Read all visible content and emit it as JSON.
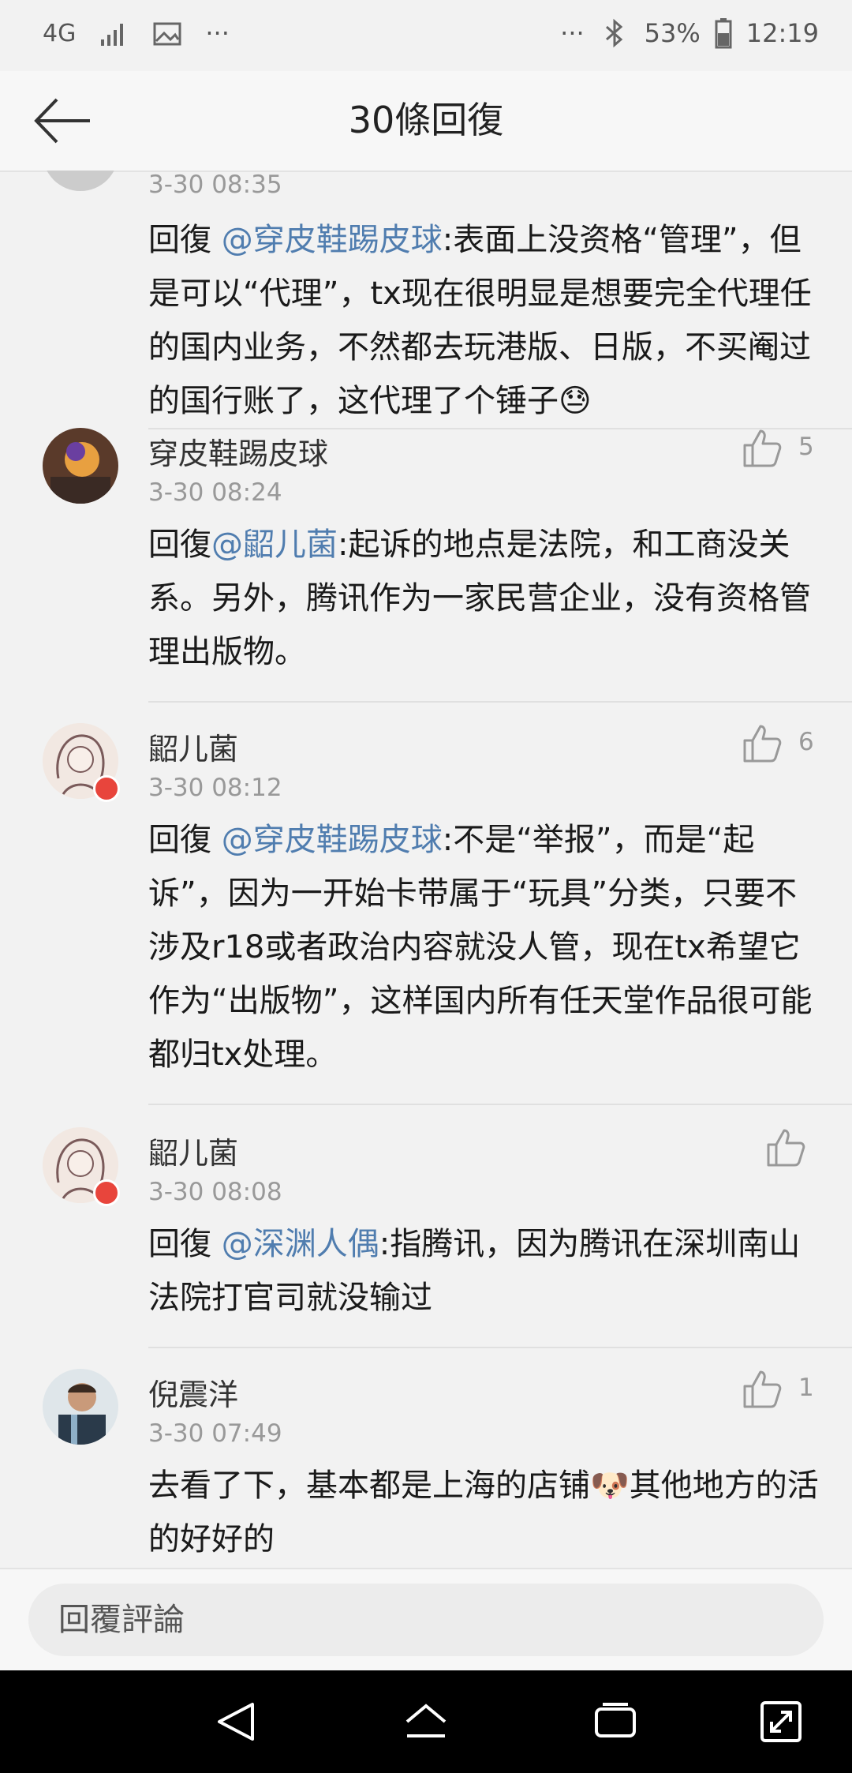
{
  "status_bar": {
    "network": "4G",
    "battery": "53%",
    "time": "12:19",
    "more_left": "···",
    "more_right": "···"
  },
  "header": {
    "title": "30條回復"
  },
  "comments": [
    {
      "time": "3-30 08:35",
      "reply_prefix": "回復 ",
      "mention": "@穿皮鞋踢皮球",
      "text": ":表面上没资格“管理”，但是可以“代理”，tx现在很明显是想要完全代理任的国内业务，不然都去玩港版、日版，不买阉过的国行账了，这代理了个锤子😓"
    },
    {
      "name": "穿皮鞋踢皮球",
      "time": "3-30 08:24",
      "likes": "5",
      "reply_prefix": "回復",
      "mention": "@鼦儿菌",
      "text": ":起诉的地点是法院，和工商没关系。另外，腾讯作为一家民营企业，没有资格管理出版物。"
    },
    {
      "name": "鼦儿菌",
      "time": "3-30 08:12",
      "likes": "6",
      "reply_prefix": "回復 ",
      "mention": "@穿皮鞋踢皮球",
      "text": ":不是“举报”，而是“起诉”，因为一开始卡带属于“玩具”分类，只要不涉及r18或者政治内容就没人管，现在tx希望它作为“出版物”，这样国内所有任天堂作品很可能都归tx处理。"
    },
    {
      "name": "鼦儿菌",
      "time": "3-30 08:08",
      "likes": "",
      "reply_prefix": "回復 ",
      "mention": "@深渊人偶",
      "text": ":指腾讯，因为腾讯在深圳南山法院打官司就没输过"
    },
    {
      "name": "倪震洋",
      "time": "3-30 07:49",
      "likes": "1",
      "reply_prefix": "",
      "mention": "",
      "text": "去看了下，基本都是上海的店铺🐶其他地方的活的好好的"
    }
  ],
  "reply_bar": {
    "placeholder": "回覆評論"
  },
  "icons": {
    "back": "back-arrow-icon",
    "like": "thumbs-up-icon",
    "nav_back": "triangle-back-icon",
    "nav_home": "home-icon",
    "nav_recents": "recents-icon",
    "nav_expand": "expand-icon"
  },
  "colors": {
    "mention": "#507daf",
    "badge": "#e8453c"
  }
}
